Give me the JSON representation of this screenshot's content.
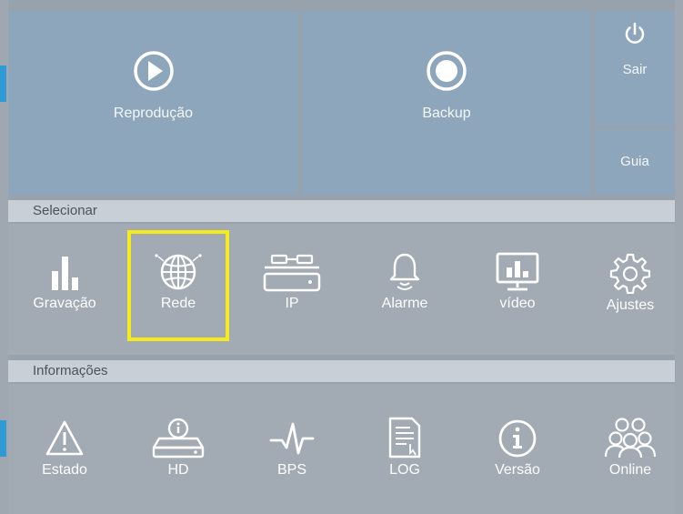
{
  "tiles": {
    "playback_label": "Reprodução",
    "backup_label": "Backup",
    "exit_label": "Sair",
    "guide_label": "Guia"
  },
  "sections": {
    "select_title": "Selecionar",
    "info_title": "Informações"
  },
  "select_items": [
    {
      "label": "Gravação",
      "icon": "bar-chart-icon"
    },
    {
      "label": "Rede",
      "icon": "globe-network-icon"
    },
    {
      "label": "IP",
      "icon": "ip-camera-device-icon"
    },
    {
      "label": "Alarme",
      "icon": "bell-icon"
    },
    {
      "label": "vídeo",
      "icon": "monitor-icon"
    },
    {
      "label": "Ajustes",
      "icon": "gear-icon"
    }
  ],
  "info_items": [
    {
      "label": "Estado",
      "icon": "warning-triangle-icon"
    },
    {
      "label": "HD",
      "icon": "hard-disk-icon"
    },
    {
      "label": "BPS",
      "icon": "pulse-icon"
    },
    {
      "label": "LOG",
      "icon": "log-document-icon"
    },
    {
      "label": "Versão",
      "icon": "info-circle-icon"
    },
    {
      "label": "Online",
      "icon": "users-icon"
    }
  ],
  "colors": {
    "tile": "#8da6bb",
    "highlight": "#f5ea1c",
    "accent": "#2e9ad6"
  }
}
